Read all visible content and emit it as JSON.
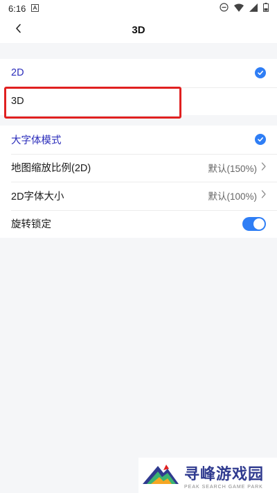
{
  "status_bar": {
    "time": "6:16",
    "icons": [
      "notification-a-icon",
      "dnd-icon",
      "wifi-icon",
      "signal-icon",
      "battery-icon"
    ]
  },
  "app_bar": {
    "title": "3D",
    "back_icon": "chevron-left-icon"
  },
  "view_mode": {
    "items": [
      {
        "label": "2D",
        "selected": true
      },
      {
        "label": "3D",
        "selected": false
      }
    ]
  },
  "settings": {
    "large_font": {
      "label": "大字体模式",
      "checked": true
    },
    "map_scale": {
      "label": "地图缩放比例(2D)",
      "value": "默认(150%)"
    },
    "font_size_2d": {
      "label": "2D字体大小",
      "value": "默认(100%)"
    },
    "rotation_lock": {
      "label": "旋转锁定",
      "on": true
    }
  },
  "watermark": {
    "title": "寻峰游戏园",
    "subtitle": "PEAK SEARCH GAME PARK"
  },
  "colors": {
    "accent": "#2f7ef5",
    "active_text": "#2b2dbb",
    "highlight": "#e02020",
    "background": "#f5f6f8"
  }
}
